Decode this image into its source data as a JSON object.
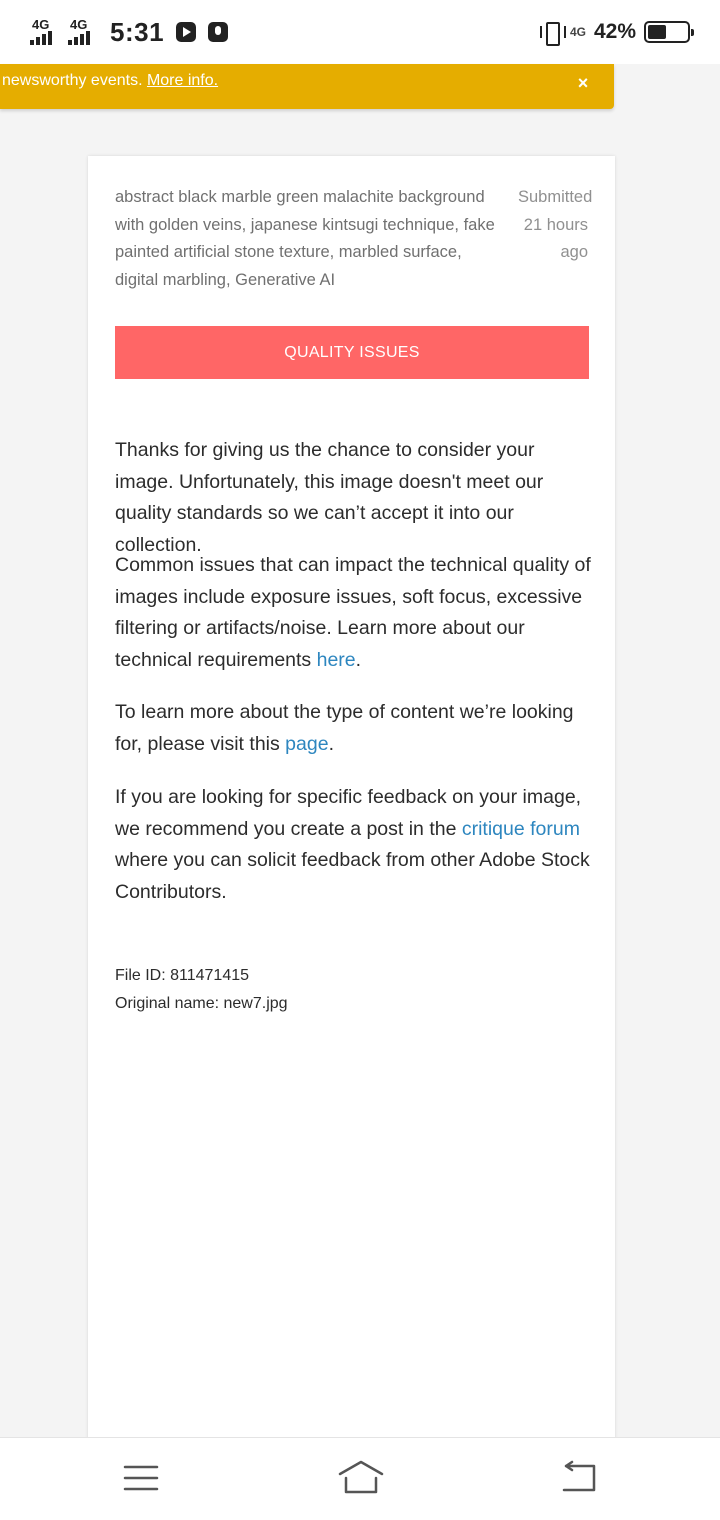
{
  "status_bar": {
    "network_1": "4G",
    "network_2": "4G",
    "time": "5:31",
    "data_network": "4G",
    "battery_percent": "42%",
    "battery_level": 0.42
  },
  "banner": {
    "text": "newsworthy events. ",
    "link": "More info.",
    "close": "×",
    "color": "#e5ad00"
  },
  "submission": {
    "description": "abstract black marble green malachite background with golden veins, japanese kintsugi technique, fake painted artificial stone texture, marbled surface, digital marbling, Generative AI",
    "submitted": "Submitted 21 hours ago",
    "status": "QUALITY ISSUES",
    "status_color": "#ff6666",
    "paragraphs": {
      "p1": "Thanks for giving us the chance to consider your image. Unfortunately, this image doesn't meet our quality standards so we can’t accept it into our collection.",
      "p2_text": "Common issues that can impact the technical quality of images include exposure issues, soft focus, excessive filtering or artifacts/noise. Learn more about our technical requirements ",
      "p2_link": "here",
      "p2_end": ".",
      "p3_text": "To learn more about the type of content we’re looking for, please visit this ",
      "p3_link": "page",
      "p3_end": ".",
      "p4_text": "If you are looking for specific feedback on your image, we recommend you create a post in the ",
      "p4_link": "critique forum",
      "p4_end": " where you can solicit feedback from other Adobe Stock Contributors."
    },
    "file_id": "File ID: 811471415",
    "original_name": "Original name: new7.jpg",
    "link_color": "#2d86bf"
  },
  "nav": {
    "icons": [
      "menu-icon",
      "home-icon",
      "back-icon"
    ]
  }
}
